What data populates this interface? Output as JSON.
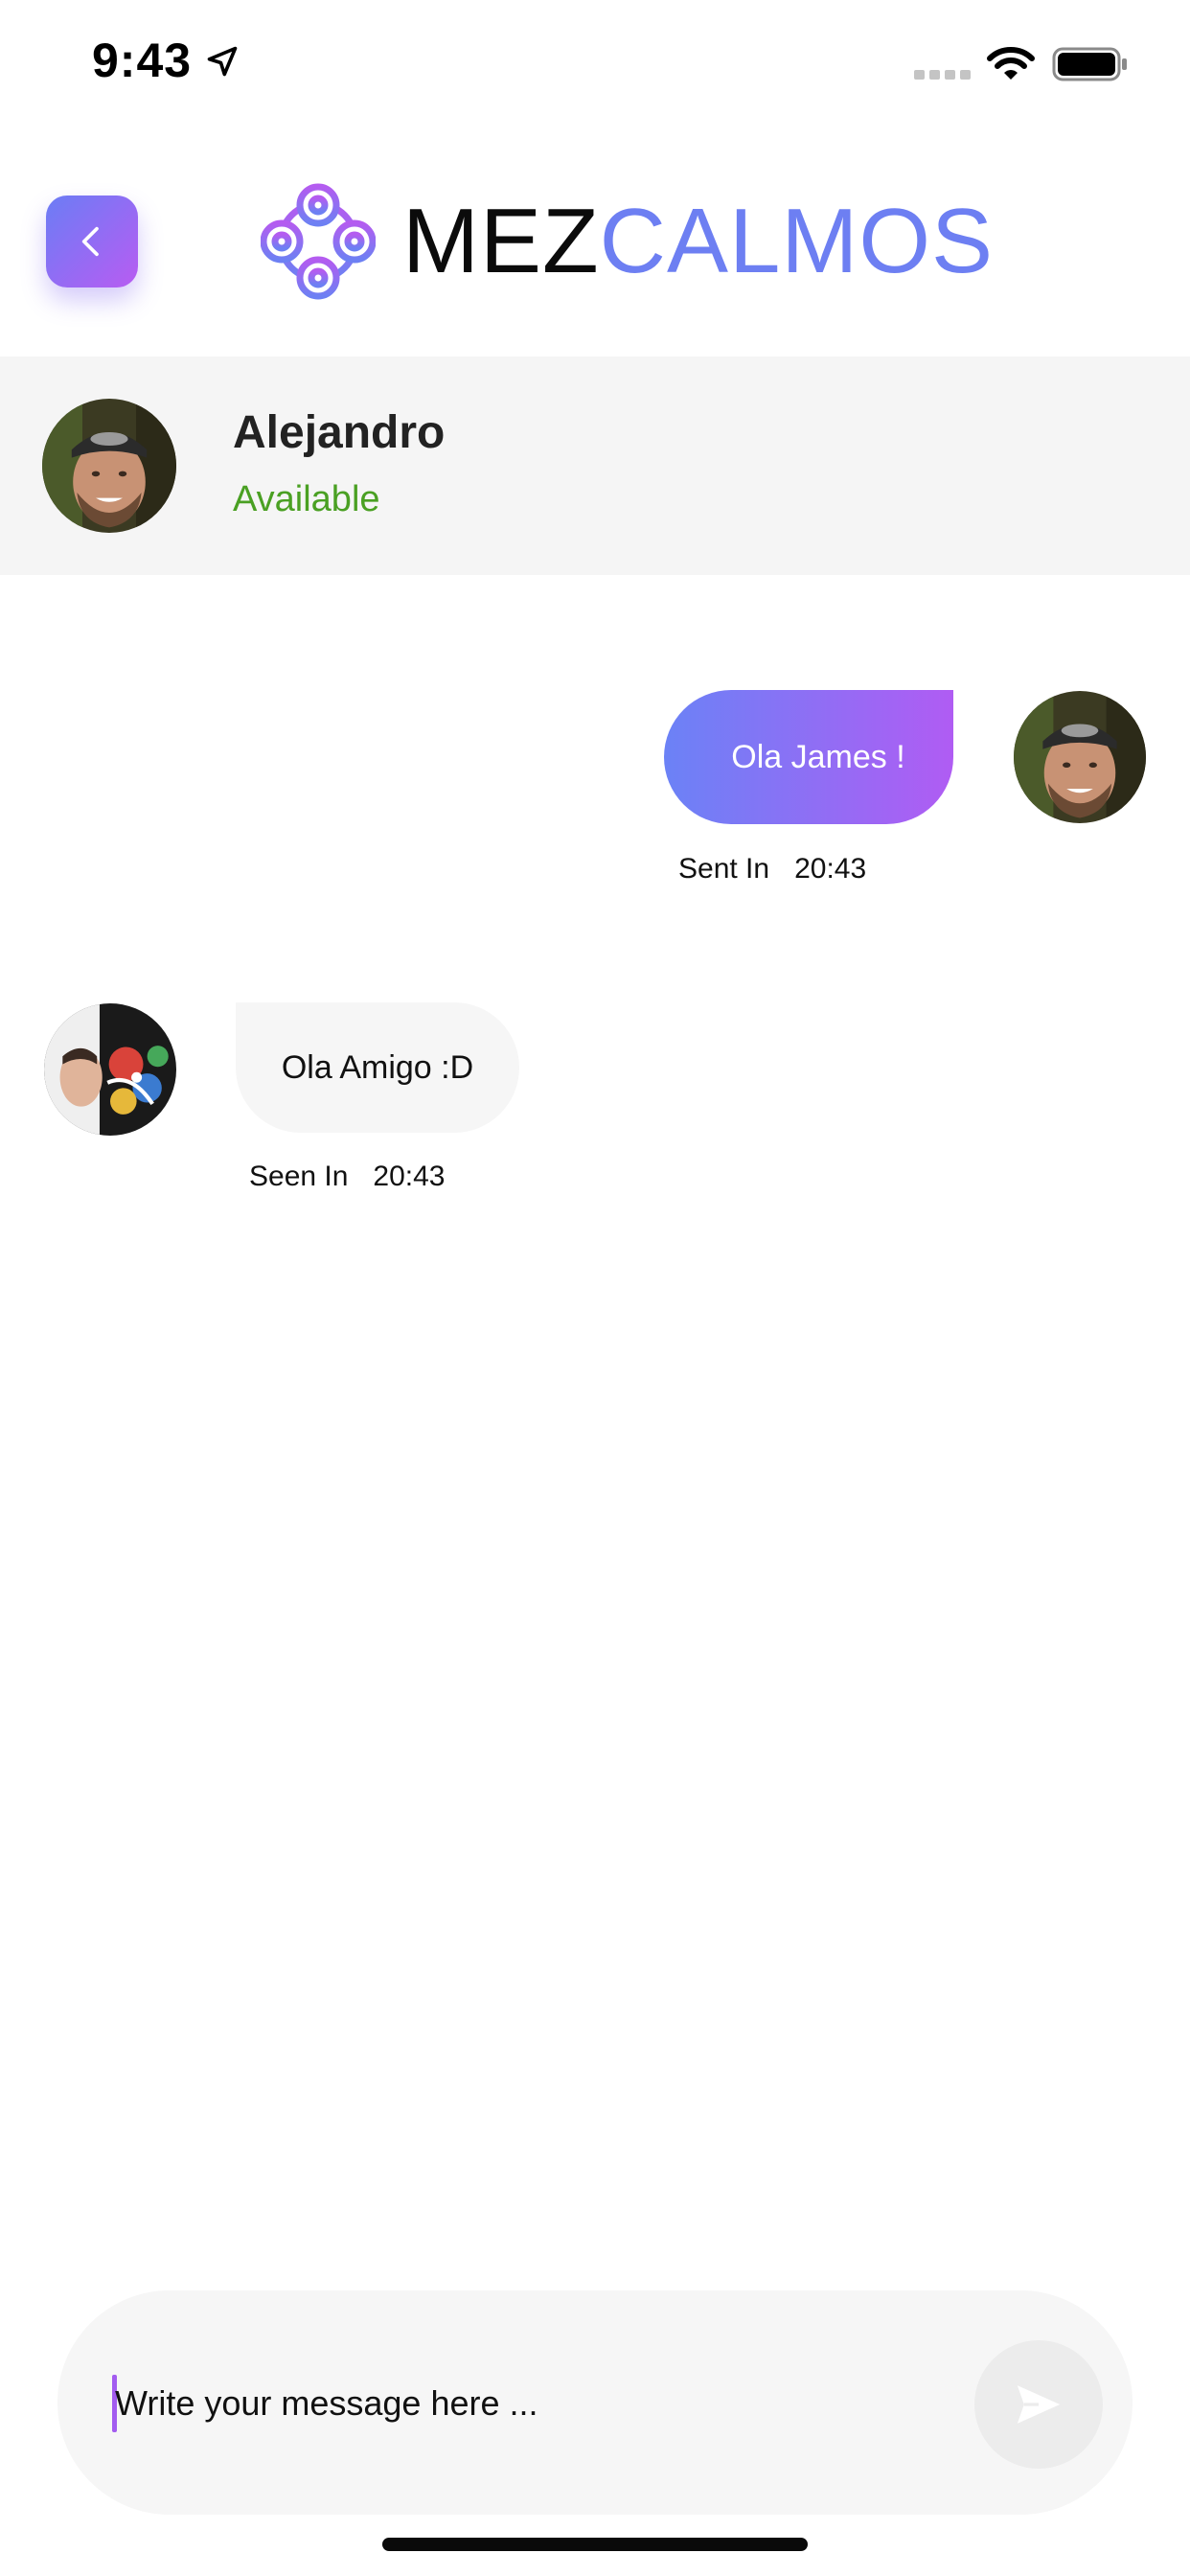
{
  "status_bar": {
    "time": "9:43",
    "icons": [
      "location-arrow-icon",
      "signal-icon",
      "wifi-icon",
      "battery-icon"
    ]
  },
  "header": {
    "back_icon": "chevron-left-icon",
    "logo_icon": "mezcalmos-logo-icon",
    "logo_text_dark": "MEZ",
    "logo_text_accent": "CALMOS"
  },
  "contact": {
    "name": "Alejandro",
    "status": "Available"
  },
  "messages": [
    {
      "direction": "outgoing",
      "text": "Ola James !",
      "meta_label": "Sent In",
      "time": "20:43"
    },
    {
      "direction": "incoming",
      "text": "Ola Amigo :D",
      "meta_label": "Seen In",
      "time": "20:43"
    }
  ],
  "composer": {
    "placeholder": "Write your message here ...",
    "value": "",
    "send_icon": "send-icon"
  },
  "colors": {
    "accent_start": "#6b82f6",
    "accent_end": "#b05cf3",
    "logo_accent": "#6d7ff2",
    "status_available": "#4aa023",
    "contact_bar_bg": "#f5f5f5",
    "bubble_incoming_bg": "#f6f6f6"
  }
}
